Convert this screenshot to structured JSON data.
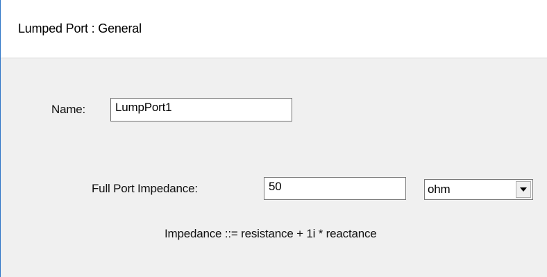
{
  "dialog": {
    "title": "Lumped Port : General"
  },
  "form": {
    "name_label": "Name:",
    "name_value": "LumpPort1",
    "impedance_label": "Full Port Impedance:",
    "impedance_value": "50",
    "unit_selected": "ohm",
    "hint_text": "Impedance ::= resistance + 1i * reactance"
  },
  "icons": {
    "dropdown": "chevron-down-icon"
  },
  "colors": {
    "panel_background": "#f0f0f0",
    "header_background": "#ffffff",
    "window_accent": "#2b73c6"
  }
}
